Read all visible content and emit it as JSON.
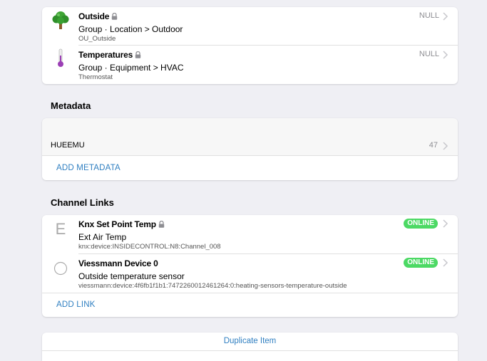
{
  "groups": {
    "items": [
      {
        "title": "Outside",
        "subtitle": "Group · Location > Outdoor",
        "footer": "OU_Outside",
        "state": "NULL",
        "icon": "tree-icon"
      },
      {
        "title": "Temperatures",
        "subtitle": "Group · Equipment > HVAC",
        "footer": "Thermostat",
        "state": "NULL",
        "icon": "thermometer-icon"
      }
    ]
  },
  "metadata": {
    "heading": "Metadata",
    "item": {
      "label": "HUEEMU",
      "value": "47"
    },
    "add_label": "ADD METADATA"
  },
  "channel_links": {
    "heading": "Channel Links",
    "items": [
      {
        "icon_letter": "E",
        "title": "Knx Set Point Temp",
        "subtitle": "Ext Air Temp",
        "footer": "knx:device:INSIDECONTROL:N8:Channel_008",
        "status": "ONLINE"
      },
      {
        "icon_letter": "",
        "title": "Viessmann Device 0",
        "subtitle": "Outside temperature sensor",
        "footer": "viessmann:device:4f6fb1f1b1:7472260012461264:0:heating-sensors-temperature-outside",
        "status": "ONLINE"
      }
    ],
    "add_label": "ADD LINK"
  },
  "actions": {
    "duplicate_label": "Duplicate Item"
  },
  "colors": {
    "accent": "#2f7fc1",
    "online": "#4cd964",
    "background": "#efeff4"
  }
}
